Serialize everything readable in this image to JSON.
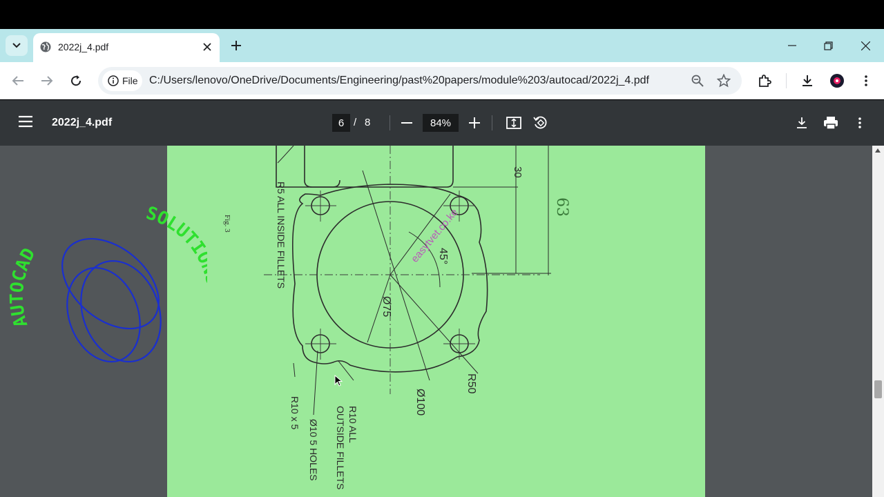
{
  "browser": {
    "tab_title": "2022j_4.pdf",
    "address_chip": "File",
    "url": "C:/Users/lenovo/OneDrive/Documents/Engineering/past%20papers/module%203/autocad/2022j_4.pdf",
    "tab_bg_color": "#b8e6ea"
  },
  "pdf_toolbar": {
    "file_name": "2022j_4.pdf",
    "current_page": "6",
    "page_separator": "/",
    "total_pages": "8",
    "zoom": "84%"
  },
  "watermark": {
    "word_left": "AUTOCAD",
    "word_right": "SOLUTIONS"
  },
  "drawing": {
    "figure_label": "Fig. 3",
    "dim_30": "30",
    "dim_63": "63",
    "dim_45": "45°",
    "dia_75": "Ø75",
    "dia_100": "Ø100",
    "radius_50": "R50",
    "r5_note": "R5 ALL INSIDE FILLETS",
    "r10x5": "R10 x 5",
    "holes_note": "Ø10 5 HOLES",
    "r10_all": "R10 ALL",
    "outside_fillets": "OUTSIDE FILLETS",
    "stamp": "easytvet.co.ke"
  }
}
